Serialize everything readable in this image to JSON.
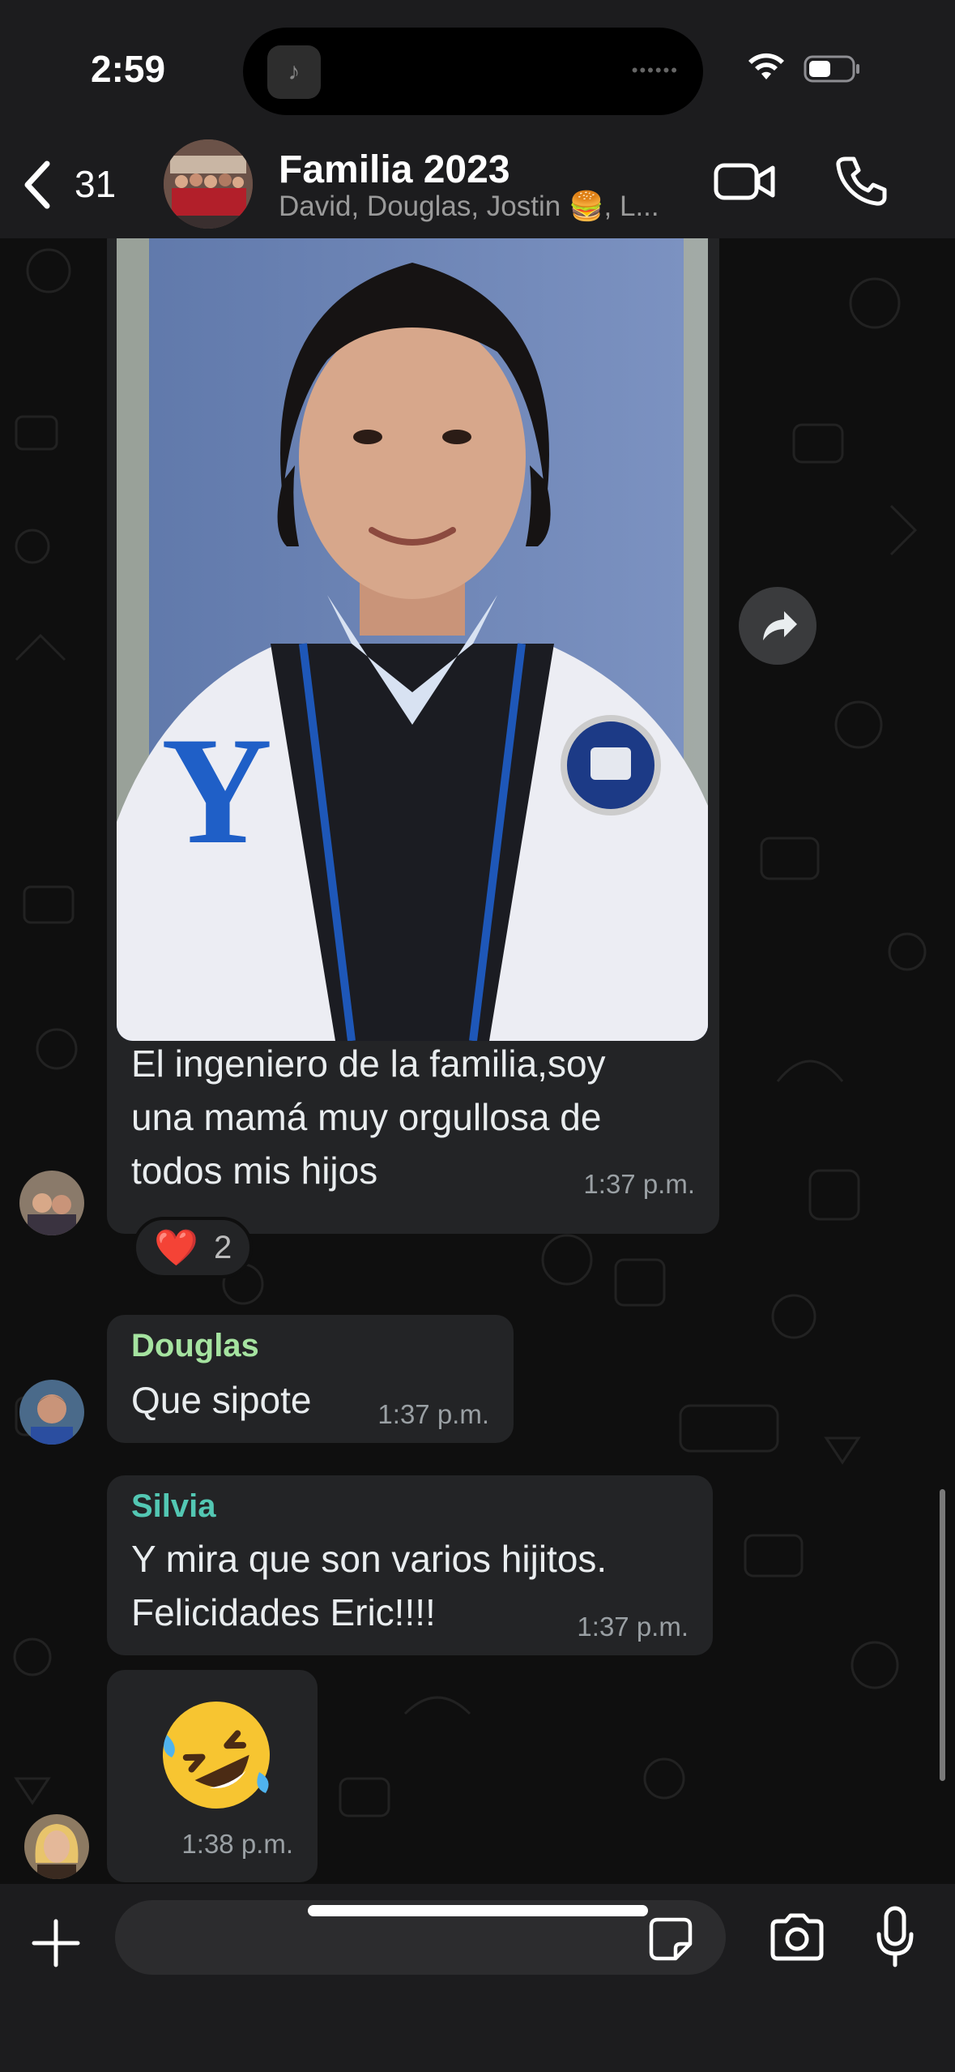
{
  "status_bar": {
    "time": "2:59",
    "island_app_glyph": "♪"
  },
  "header": {
    "back_count": "31",
    "title": "Familia 2023",
    "subtitle": "David, Douglas, Jostin 🍔, L..."
  },
  "messages": [
    {
      "type": "image_caption",
      "text_lines": [
        "El ingeniero de la familia,soy",
        "una mamá muy orgullosa de",
        "todos mis hijos"
      ],
      "time": "1:37 p.m.",
      "reaction": {
        "emoji": "❤️",
        "count": "2"
      }
    },
    {
      "type": "text",
      "sender": "Douglas",
      "sender_color": "#a5e3a0",
      "text": "Que sipote",
      "time": "1:37 p.m."
    },
    {
      "type": "text",
      "sender": "Silvia",
      "sender_color": "#53c7b3",
      "text_lines": [
        "Y mira que son varios hijitos.",
        "Felicidades Eric!!!!"
      ],
      "time": "1:37 p.m."
    },
    {
      "type": "emoji",
      "emoji_name": "rolling-on-floor-laughing",
      "time": "1:38 p.m."
    }
  ],
  "composer": {
    "placeholder": ""
  },
  "colors": {
    "bar_bg": "#1c1c1e",
    "bubble_bg": "#232426",
    "chat_bg": "#0f0f0f"
  }
}
